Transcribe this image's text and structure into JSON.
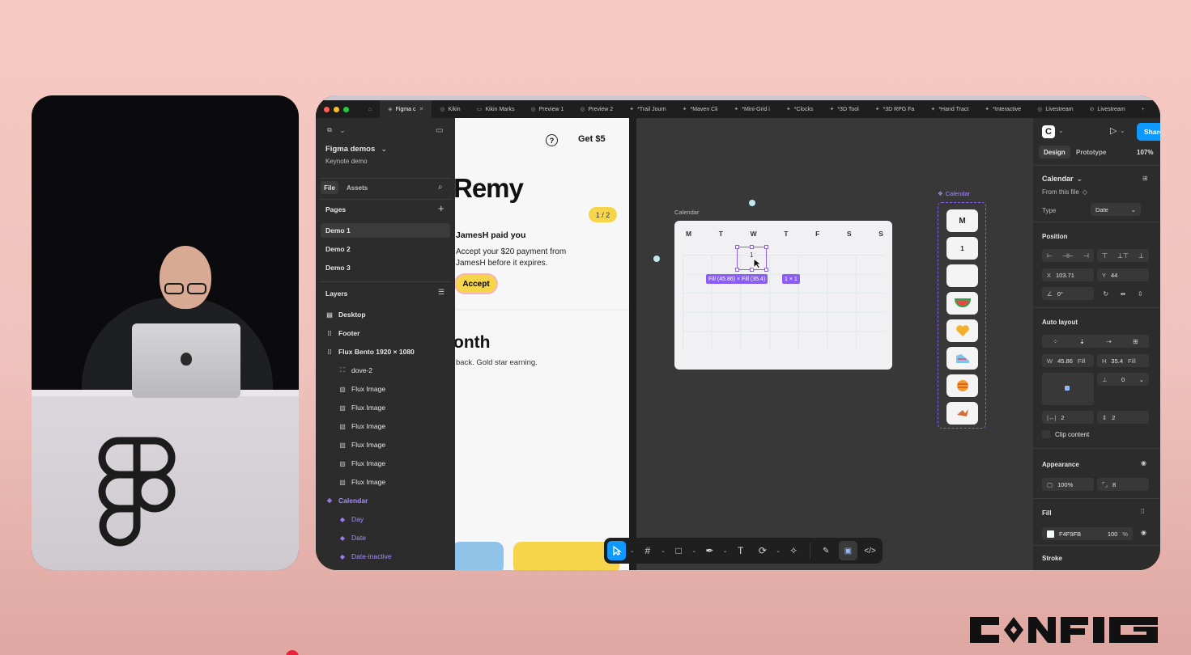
{
  "tabs": [
    {
      "label": "Figma c",
      "active": true
    },
    {
      "label": "Kikin"
    },
    {
      "label": "Kikin Marks"
    },
    {
      "label": "Preview 1"
    },
    {
      "label": "Preview 2"
    },
    {
      "label": "*Trail Journ"
    },
    {
      "label": "*Maven Cli"
    },
    {
      "label": "*Mini-Grid i"
    },
    {
      "label": "*Clocks"
    },
    {
      "label": "*3D Tool"
    },
    {
      "label": "*3D RPG Fa"
    },
    {
      "label": "*Hand Tract"
    },
    {
      "label": "*Interactive"
    },
    {
      "label": "Livestream"
    },
    {
      "label": "Livestream"
    }
  ],
  "left_panel": {
    "team": "Figma demos",
    "file": "Keynote demo",
    "tab_file": "File",
    "tab_assets": "Assets",
    "pages_title": "Pages",
    "pages": [
      "Demo 1",
      "Demo 2",
      "Demo 3"
    ],
    "layers_title": "Layers",
    "layers": [
      {
        "label": "Desktop",
        "icon": "frame-icon"
      },
      {
        "label": "Footer",
        "icon": "autolayout-icon"
      },
      {
        "label": "Flux Bento 1920 × 1080",
        "icon": "autolayout-icon"
      },
      {
        "label": "dove-2",
        "icon": "image-icon"
      },
      {
        "label": "Flux Image",
        "icon": "image-icon"
      },
      {
        "label": "Flux Image",
        "icon": "image-icon"
      },
      {
        "label": "Flux Image",
        "icon": "image-icon"
      },
      {
        "label": "Flux Image",
        "icon": "image-icon"
      },
      {
        "label": "Flux Image",
        "icon": "image-icon"
      },
      {
        "label": "Flux Image",
        "icon": "image-icon"
      },
      {
        "label": "Calendar",
        "icon": "component-icon"
      },
      {
        "label": "Day",
        "icon": "variant-icon"
      },
      {
        "label": "Date",
        "icon": "variant-icon"
      },
      {
        "label": "Date-inactive",
        "icon": "variant-icon"
      }
    ]
  },
  "phone": {
    "get_label": "Get $5",
    "name": "Remy",
    "counter": "1 / 2",
    "card_title": "JamesH paid you",
    "card_body": "Accept your $20 payment from JamesH before it expires.",
    "accept": "Accept",
    "month_heading": "onth",
    "month_sub": "back. Gold star earning."
  },
  "canvas": {
    "calendar_label": "Calendar",
    "days": [
      "M",
      "T",
      "W",
      "T",
      "F",
      "S",
      "S"
    ],
    "cell_value": "1",
    "size_tag": "Fill (45.86) × Fill (35.4)",
    "ratio_tag": "1 × 1",
    "component_set_label": "Calendar",
    "component_items": [
      "M",
      "1",
      "",
      "watermelon-icon",
      "heart-icon",
      "sneaker-icon",
      "ball-icon",
      "bird-icon"
    ]
  },
  "right_panel": {
    "share": "Share",
    "tab_design": "Design",
    "tab_prototype": "Prototype",
    "zoom": "107%",
    "component_name": "Calendar",
    "from_file": "From this file",
    "type_label": "Type",
    "type_value": "Date",
    "position_title": "Position",
    "x_label": "X",
    "x_value": "103.71",
    "y_label": "Y",
    "y_value": "44",
    "rotation": "0°",
    "auto_layout_title": "Auto layout",
    "w_label": "W",
    "w_value": "45.86",
    "w_mode": "Fill",
    "h_label": "H",
    "h_value": "35.4",
    "h_mode": "Fill",
    "gap_value": "0",
    "pad_h": "2",
    "pad_v": "2",
    "clip_content": "Clip content",
    "appearance_title": "Appearance",
    "opacity": "100%",
    "radius": "8",
    "fill_title": "Fill",
    "fill_hex": "F4F9FB",
    "fill_opacity": "100",
    "fill_pct": "%",
    "stroke_title": "Stroke"
  },
  "colors": {
    "accent": "#0d99ff",
    "selection": "#8b5cf6",
    "yellow": "#f6d54a",
    "background": "#f6c9c2"
  }
}
